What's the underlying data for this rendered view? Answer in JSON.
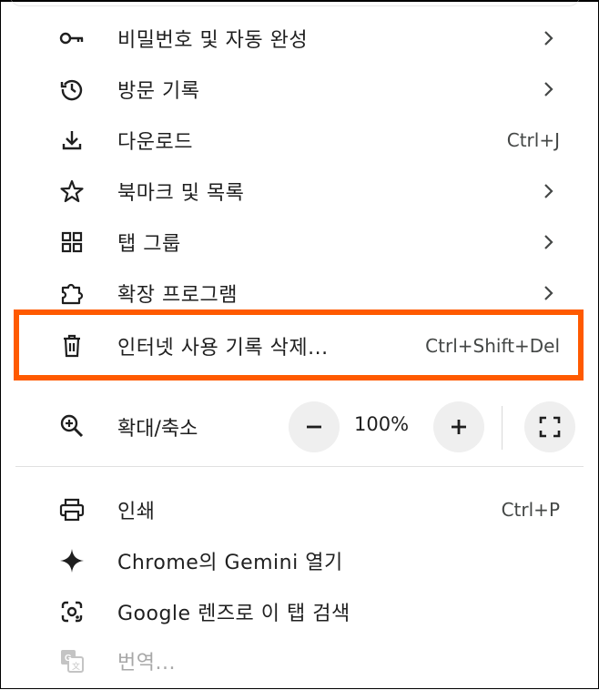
{
  "menu": {
    "items": [
      {
        "label": "비밀번호 및 자동 완성",
        "icon": "key-icon",
        "submenu": true
      },
      {
        "label": "방문 기록",
        "icon": "history-icon",
        "submenu": true
      },
      {
        "label": "다운로드",
        "icon": "download-icon",
        "shortcut": "Ctrl+J"
      },
      {
        "label": "북마크 및 목록",
        "icon": "star-icon",
        "submenu": true
      },
      {
        "label": "탭 그룹",
        "icon": "grid-icon",
        "submenu": true
      },
      {
        "label": "확장 프로그램",
        "icon": "puzzle-icon",
        "submenu": true
      },
      {
        "label": "인터넷 사용 기록 삭제...",
        "icon": "trash-icon",
        "shortcut": "Ctrl+Shift+Del",
        "highlighted": true
      }
    ],
    "zoom": {
      "label": "확대/축소",
      "value": "100%",
      "icon": "zoom-in-icon"
    },
    "items2": [
      {
        "label": "인쇄",
        "icon": "printer-icon",
        "shortcut": "Ctrl+P"
      },
      {
        "label": "Chrome의 Gemini 열기",
        "icon": "sparkle-icon"
      },
      {
        "label": "Google 렌즈로 이 탭 검색",
        "icon": "lens-icon"
      },
      {
        "label": "번역...",
        "icon": "translate-icon",
        "disabled": true
      }
    ]
  },
  "colors": {
    "highlight": "#ff5a00",
    "text": "#1f1f1f",
    "muted": "#a8a8a8"
  }
}
